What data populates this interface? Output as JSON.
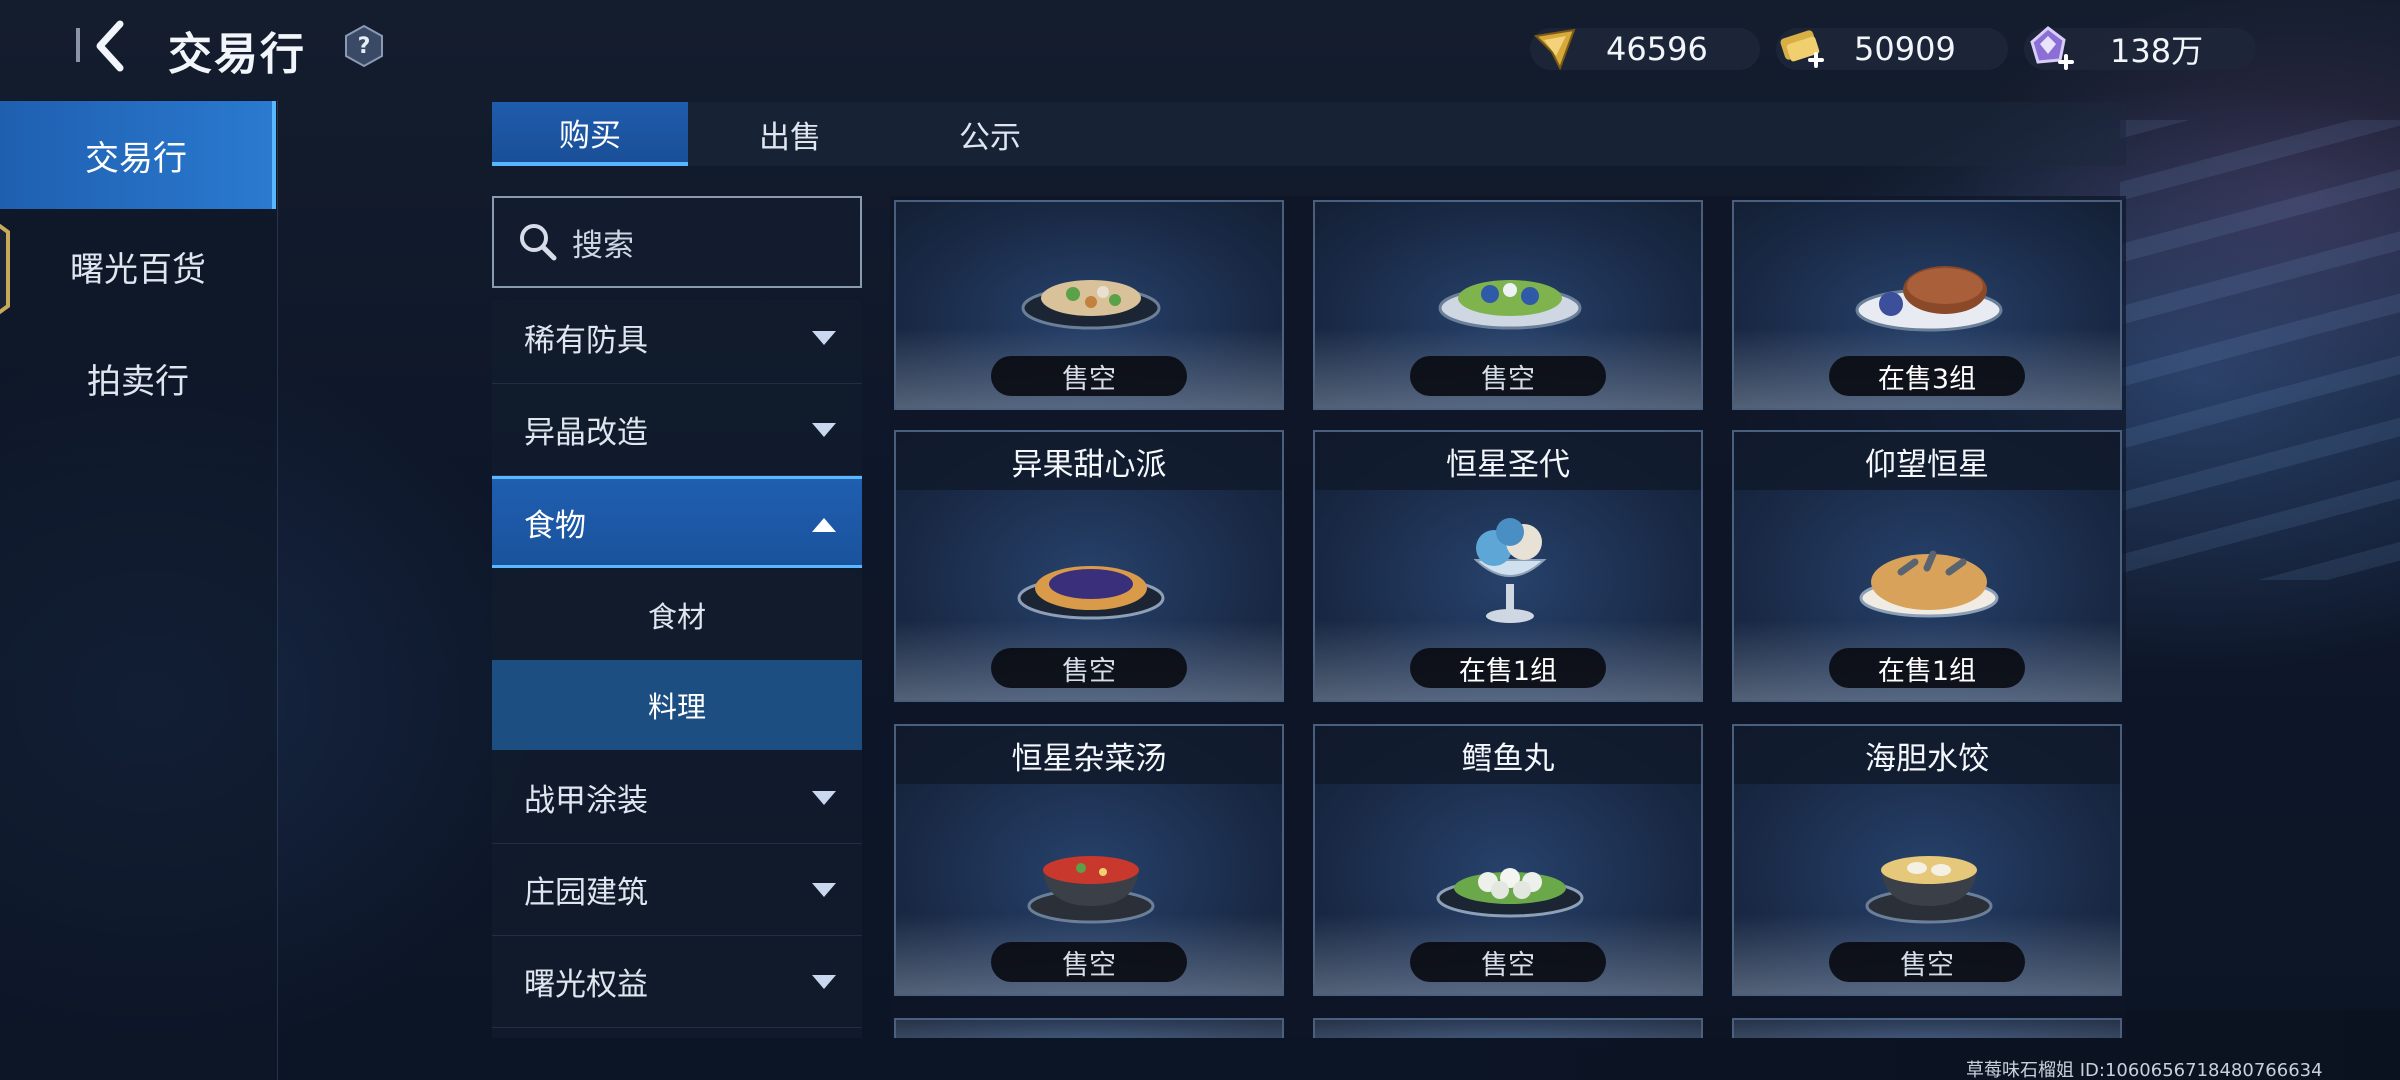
{
  "header": {
    "title": "交易行",
    "help_label": "?",
    "currencies": [
      {
        "icon": "gold-wing-currency-icon",
        "value": "46596"
      },
      {
        "icon": "gold-ticket-currency-icon",
        "value": "50909"
      },
      {
        "icon": "purple-crystal-currency-icon",
        "value": "138万"
      }
    ]
  },
  "sidebar": {
    "items": [
      {
        "label": "交易行",
        "active": true
      },
      {
        "label": "曙光百货",
        "active": false
      },
      {
        "label": "拍卖行",
        "active": false
      }
    ]
  },
  "tabs": [
    {
      "label": "购买",
      "active": true
    },
    {
      "label": "出售",
      "active": false
    },
    {
      "label": "公示",
      "active": false
    }
  ],
  "search": {
    "placeholder": "搜索"
  },
  "categories": [
    {
      "label": "稀有防具"
    },
    {
      "label": "异晶改造"
    },
    {
      "label": "食物",
      "expanded": true
    },
    {
      "label": "战甲涂装"
    },
    {
      "label": "庄园建筑"
    },
    {
      "label": "曙光权益"
    }
  ],
  "subcategories": [
    {
      "label": "食材",
      "active": false
    },
    {
      "label": "料理",
      "active": true
    }
  ],
  "items": [
    {
      "name": "",
      "food": "stir-fry-dish-icon",
      "status": "售空"
    },
    {
      "name": "",
      "food": "salad-dish-icon",
      "status": "售空"
    },
    {
      "name": "",
      "food": "pancake-dish-icon",
      "status": "在售3组"
    },
    {
      "name": "异果甜心派",
      "food": "berry-pie-icon",
      "status": "售空"
    },
    {
      "name": "恒星圣代",
      "food": "sundae-icon",
      "status": "在售1组"
    },
    {
      "name": "仰望恒星",
      "food": "stargazy-pie-icon",
      "status": "在售1组"
    },
    {
      "name": "恒星杂菜汤",
      "food": "vegetable-soup-icon",
      "status": "售空"
    },
    {
      "name": "鳕鱼丸",
      "food": "fish-balls-icon",
      "status": "售空"
    },
    {
      "name": "海胆水饺",
      "food": "dumpling-soup-icon",
      "status": "售空"
    }
  ],
  "footer": {
    "player_info": "草莓味石榴姐  ID:1060656718480766634"
  },
  "colors": {
    "accent": "#2a7ad0",
    "highlight": "#56b6ff"
  }
}
